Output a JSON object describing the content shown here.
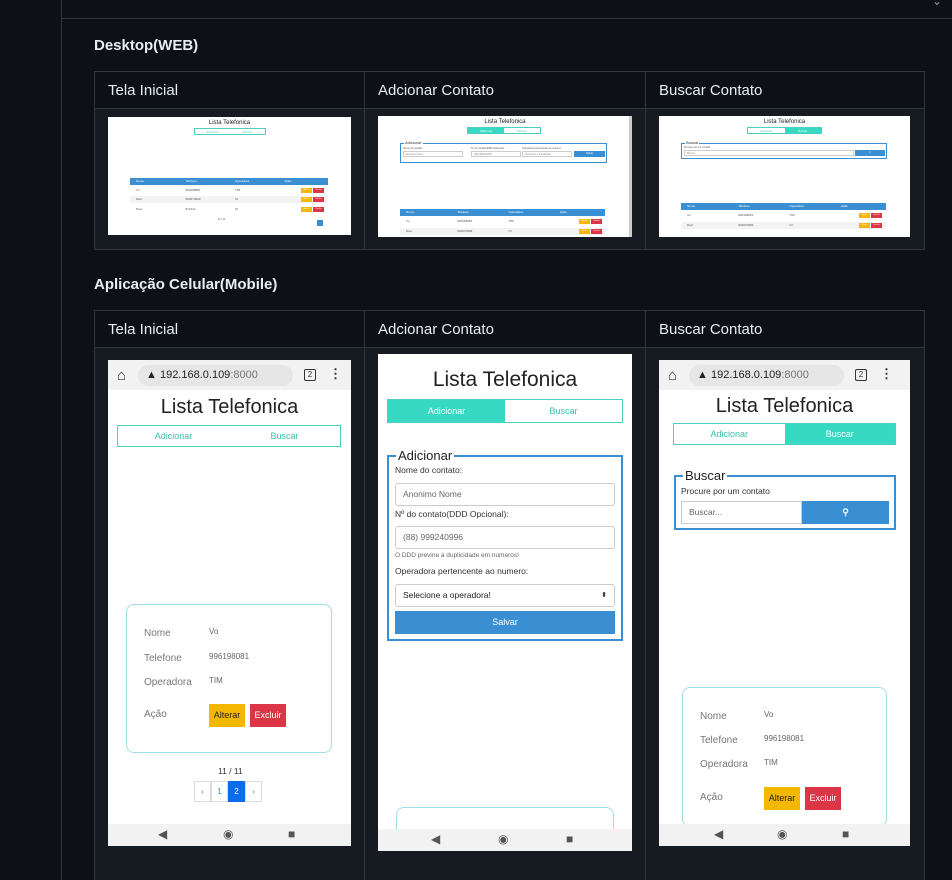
{
  "sections": {
    "desktop_title": "Desktop(WEB)",
    "mobile_title": "Aplicação Celular(Mobile)"
  },
  "columns": [
    "Tela Inicial",
    "Adcionar Contato",
    "Buscar Contato"
  ],
  "app": {
    "title": "Lista Telefonica",
    "tab_add": "Adicionar",
    "tab_search": "Buscar",
    "table_headers": [
      "Nome",
      "Telefone",
      "Operadora",
      "Ação"
    ],
    "rows": [
      {
        "nome": "Vo",
        "telefone": "996198081",
        "operadora": "TIM"
      },
      {
        "nome": "Davi",
        "telefone": "992670999",
        "operadora": "OI"
      },
      {
        "nome": "Davi",
        "telefone": "871212",
        "operadora": "OI"
      }
    ],
    "btn_alterar": "Alterar",
    "btn_excluir": "Excluir",
    "pager_text": "11 / 11",
    "pager_items": [
      "‹",
      "1",
      "2",
      "›"
    ],
    "add_legend": "Adicionar",
    "label_nome": "Nome do contato:",
    "placeholder_nome": "Anonimo Nome",
    "label_numero": "Nº do contato(DDD Opcional):",
    "placeholder_numero": "(88) 999240996",
    "hint_ddd": "O DDD previne a duplicidade em numeros!",
    "label_operadora": "Operadora pertencente ao numero:",
    "select_operadora": "Selecione a operadora!",
    "btn_salvar": "Salvar",
    "search_legend": "Buscar",
    "search_hint": "Procure por um contato",
    "search_placeholder": "Buscar...",
    "card_labels": [
      "Nome",
      "Telefone",
      "Operadora",
      "Ação"
    ]
  },
  "browser": {
    "url_host": "192.168.0.109",
    "url_port": ":8000",
    "tab_count": "2"
  },
  "icons": {
    "home": "home-icon",
    "warning": "warning-icon",
    "menu": "kebab-menu-icon",
    "back": "back-icon",
    "home_nav": "home-nav-icon",
    "recents": "recents-icon",
    "search": "search-icon"
  },
  "colors": {
    "teal": "#38d9c3",
    "blue": "#3a8fd3",
    "yellow": "#f5b800",
    "red": "#dc3545"
  }
}
